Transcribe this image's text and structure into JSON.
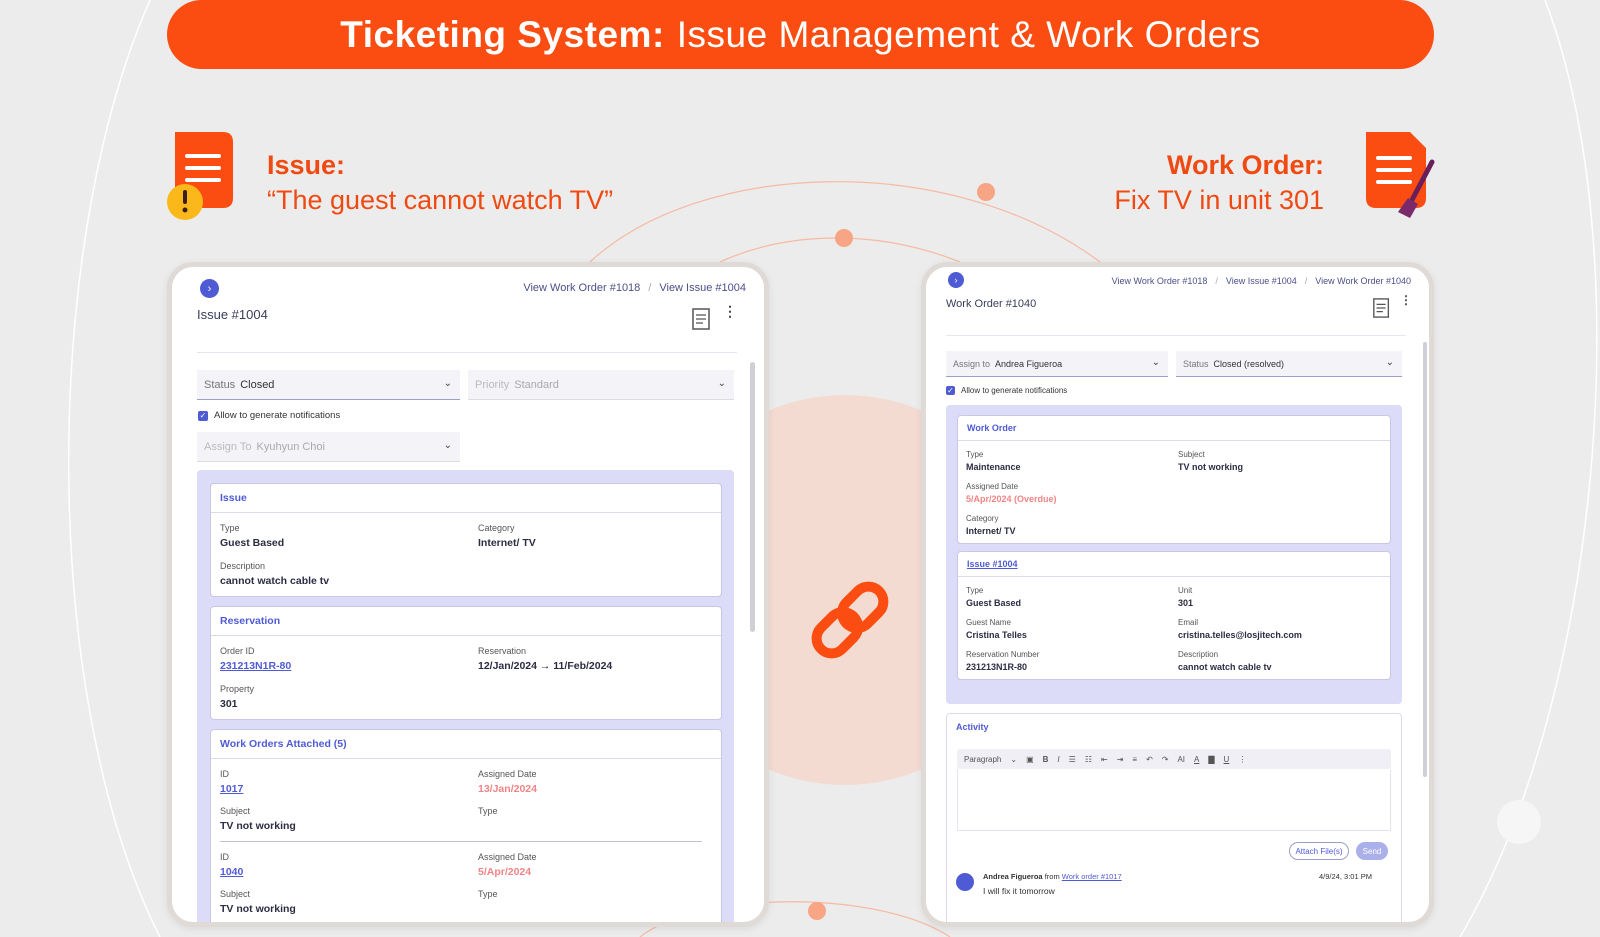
{
  "banner": {
    "bold": "Ticketing System:",
    "light": "Issue Management & Work Orders"
  },
  "issue_header": {
    "title": "Issue:",
    "subtitle": "“The guest cannot watch TV”"
  },
  "workorder_header": {
    "title": "Work Order:",
    "subtitle": "Fix TV in unit 301"
  },
  "colors": {
    "accent": "#fb4d12",
    "primary": "#4f5bd5",
    "lavender": "#dcdcf8",
    "overdue": "#f08585"
  },
  "left": {
    "breadcrumbs": [
      "View Work Order #1018",
      "View Issue #1004"
    ],
    "title": "Issue #1004",
    "status": {
      "label": "Status",
      "value": "Closed"
    },
    "priority": {
      "label": "Priority",
      "value": "Standard"
    },
    "notify": "Allow to generate notifications",
    "assign": {
      "label": "Assign To",
      "value": "Kyuhyun Choi"
    },
    "issue_card": {
      "title": "Issue",
      "type_k": "Type",
      "type_v": "Guest Based",
      "cat_k": "Category",
      "cat_v": "Internet/ TV",
      "desc_k": "Description",
      "desc_v": "cannot watch cable tv"
    },
    "reservation_card": {
      "title": "Reservation",
      "order_k": "Order ID",
      "order_v": "231213N1R-80",
      "res_k": "Reservation",
      "res_v": "12/Jan/2024 → 11/Feb/2024",
      "prop_k": "Property",
      "prop_v": "301"
    },
    "workorders_card": {
      "title": "Work Orders Attached (5)",
      "rows": [
        {
          "id_k": "ID",
          "id_v": "1017",
          "date_k": "Assigned Date",
          "date_v": "13/Jan/2024",
          "subj_k": "Subject",
          "subj_v": "TV not working",
          "type_k": "Type"
        },
        {
          "id_k": "ID",
          "id_v": "1040",
          "date_k": "Assigned Date",
          "date_v": "5/Apr/2024",
          "subj_k": "Subject",
          "subj_v": "TV not working",
          "type_k": "Type"
        }
      ]
    }
  },
  "right": {
    "breadcrumbs": [
      "View Work Order #1018",
      "View Issue #1004",
      "View Work Order #1040"
    ],
    "title": "Work Order #1040",
    "assign": {
      "label": "Assign to",
      "value": "Andrea Figueroa"
    },
    "status": {
      "label": "Status",
      "value": "Closed (resolved)"
    },
    "notify": "Allow to generate notifications",
    "wo_card": {
      "title": "Work Order",
      "type_k": "Type",
      "type_v": "Maintenance",
      "subj_k": "Subject",
      "subj_v": "TV not working",
      "date_k": "Assigned Date",
      "date_v": "5/Apr/2024 (Overdue)",
      "cat_k": "Category",
      "cat_v": "Internet/ TV"
    },
    "issue_card": {
      "title": "Issue #1004",
      "type_k": "Type",
      "type_v": "Guest Based",
      "unit_k": "Unit",
      "unit_v": "301",
      "guest_k": "Guest Name",
      "guest_v": "Cristina Telles",
      "email_k": "Email",
      "email_v": "cristina.telles@losjitech.com",
      "resnum_k": "Reservation Number",
      "resnum_v": "231213N1R-80",
      "desc_k": "Description",
      "desc_v": "cannot watch cable tv"
    },
    "activity": {
      "title": "Activity",
      "toolbar": [
        "Paragraph",
        "⌄",
        "▣",
        "B",
        "I",
        "☰",
        "☷",
        "⇤",
        "⇥",
        "≡",
        "↶",
        "↷",
        "AI",
        "A",
        "▇",
        "U",
        "⋮"
      ],
      "attach": "Attach File(s)",
      "send": "Send",
      "comment_author": "Andrea Figueroa",
      "comment_from": "from",
      "comment_link": "Work order #1017",
      "comment_time": "4/9/24, 3:01 PM",
      "comment_text": "I will fix it tomorrow"
    }
  }
}
